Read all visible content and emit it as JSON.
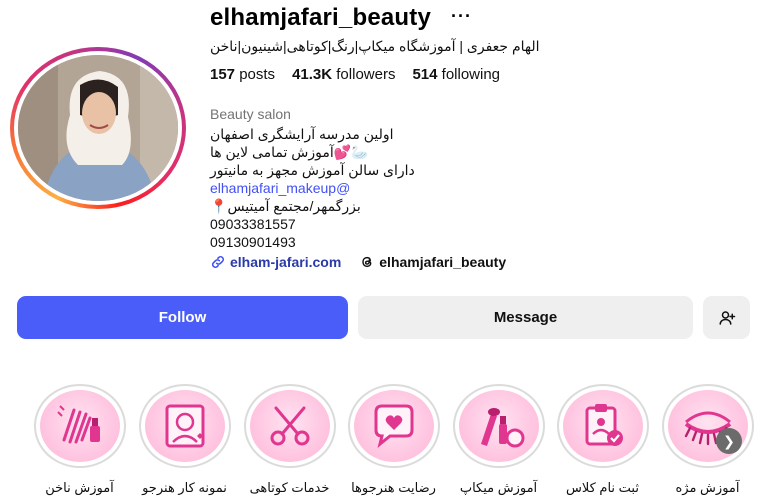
{
  "profile": {
    "username": "elhamjafari_beauty",
    "full_name": "الهام جعفری | آموزشگاه میکاپ|رنگ|کوتاهی|شینیون|ناخن",
    "stats": {
      "posts_count": "157",
      "posts_label": "posts",
      "followers_count": "41.3K",
      "followers_label": "followers",
      "following_count": "514",
      "following_label": "following"
    },
    "category": "Beauty salon",
    "bio_lines": [
      "اولین مدرسه آرایشگری اصفهان",
      "آموزش تمامی لاین ها💕🦢",
      "دارای سالن آموزش مجهز به مانیتور",
      "elhamjafari_makeup@",
      "📍بزرگمهر/مجتمع آمیتیس",
      "09033381557",
      "09130901493"
    ],
    "website": "elham-jafari.com",
    "threads_handle": "elhamjafari_beauty"
  },
  "actions": {
    "follow_label": "Follow",
    "message_label": "Message"
  },
  "highlights": [
    {
      "label": "آموزش ناخن",
      "icon": "nail-polish-icon"
    },
    {
      "label": "نمونه کار هنرجو",
      "icon": "portrait-frame-icon"
    },
    {
      "label": "خدمات کوتاهی",
      "icon": "scissors-icon"
    },
    {
      "label": "رضایت هنرجوها",
      "icon": "heart-chat-icon"
    },
    {
      "label": "آموزش میکاپ",
      "icon": "makeup-icon"
    },
    {
      "label": "ثبت نام کلاس",
      "icon": "clipboard-icon"
    },
    {
      "label": "آموزش مژه",
      "icon": "eyelash-icon"
    }
  ],
  "colors": {
    "follow_button": "#4a5df9",
    "secondary_button": "#efefef",
    "link_blue": "#4150f7",
    "highlight_pink": "#ffc2df"
  }
}
